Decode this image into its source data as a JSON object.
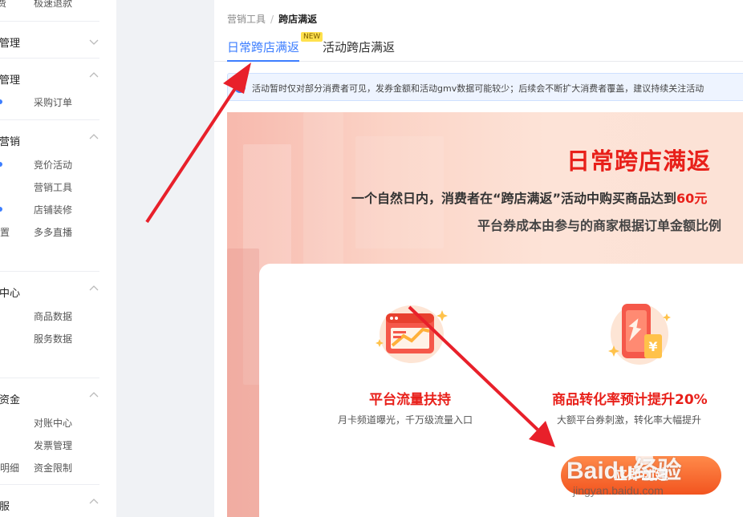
{
  "sidebar": {
    "top_items": [
      "费",
      "极速退款"
    ],
    "groups": [
      {
        "title": "品管理",
        "items": []
      },
      {
        "title": "单管理",
        "items": [
          {
            "left": "",
            "right": "采购订单"
          }
        ]
      },
      {
        "title": "销营销",
        "items": [
          {
            "left": "",
            "right": "竞价活动"
          },
          {
            "left": "",
            "right": "营销工具"
          },
          {
            "left": "",
            "right": "店铺装修"
          },
          {
            "left": "置",
            "right": "多多直播"
          }
        ]
      },
      {
        "title": "据中心",
        "items": [
          {
            "left": "",
            "right": "商品数据"
          },
          {
            "left": "",
            "right": "服务数据"
          }
        ]
      },
      {
        "title": "户资金",
        "items": [
          {
            "left": "",
            "right": "对账中心"
          },
          {
            "left": "",
            "right": "发票管理"
          },
          {
            "left": "明细",
            "right": "资金限制"
          }
        ]
      },
      {
        "title": "客服",
        "items": []
      }
    ]
  },
  "breadcrumb": {
    "parent": "营销工具",
    "separator": "/",
    "current": "跨店满返"
  },
  "tabs": [
    {
      "label": "日常跨店满返",
      "active": true,
      "badge": "NEW"
    },
    {
      "label": "活动跨店满返",
      "active": false
    }
  ],
  "notice": {
    "icon": "info-icon",
    "text": "活动暂时仅对部分消费者可见，发券金额和活动gmv数据可能较少；后续会不断扩大消费者覆盖，建议持续关注活动"
  },
  "banner": {
    "title": "日常跨店满返",
    "desc_line1_prefix": "一个自然日内，消费者在“跨店满返”活动中购买商品达到",
    "desc_line1_highlight": "60元",
    "desc_line2": "平台券成本由参与的商家根据订单金额比例"
  },
  "features": [
    {
      "icon": "traffic-chart-icon",
      "title": "平台流量扶持",
      "desc": "月卡频道曝光，千万级流量入口"
    },
    {
      "icon": "phone-growth-icon",
      "title": "商品转化率预计提升20%",
      "desc": "大额平台券刺激，转化率大幅提升"
    }
  ],
  "create_button": {
    "label": "立即创建"
  },
  "watermark": {
    "main": "Baidu经验",
    "sub": "jingyan.baidu.com"
  },
  "colors": {
    "accent": "#3d7eff",
    "brand_red": "#e8201a",
    "button_orange": "#f2541f",
    "arrow": "#e8202a"
  }
}
